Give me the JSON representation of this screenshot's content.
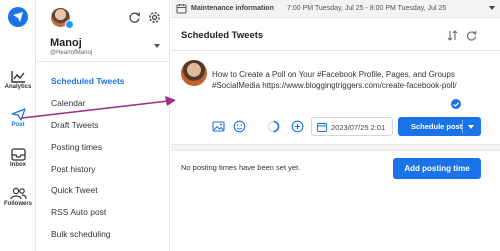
{
  "rail": {
    "items": [
      {
        "label": "Analytics",
        "icon": "chart-line-icon"
      },
      {
        "label": "Post",
        "icon": "paper-plane-icon"
      },
      {
        "label": "Inbox",
        "icon": "inbox-icon"
      },
      {
        "label": "Followers",
        "icon": "followers-icon"
      }
    ]
  },
  "account": {
    "name": "Manoj",
    "handle": "@HeartofManoj"
  },
  "menu": {
    "items": [
      {
        "label": "Scheduled Tweets",
        "active": true
      },
      {
        "label": "Calendar"
      },
      {
        "label": "Draft Tweets"
      },
      {
        "label": "Posting times"
      },
      {
        "label": "Post history"
      },
      {
        "label": "Quick Tweet"
      },
      {
        "label": "RSS Auto post"
      },
      {
        "label": "Bulk scheduling"
      }
    ]
  },
  "banner": {
    "title": "Maintenance information",
    "text": "7:00 PM Tuesday, Jul 25 - 8:00 PM Tuesday, Jul 25"
  },
  "main": {
    "title": "Scheduled Tweets"
  },
  "tweet": {
    "text": "How to Create a Poll on Your #Facebook Profile, Pages, and Groups #SocialMedia https://www.bloggingtriggers.com/create-facebook-poll/"
  },
  "composer": {
    "date_value": "2023/07/25 2:01",
    "schedule_label": "Schedule post"
  },
  "posting_times": {
    "empty_text": "No posting times have been set yet.",
    "add_label": "Add posting time"
  },
  "colors": {
    "accent": "#1a73e8",
    "annotation_arrow": "#a0307f"
  }
}
